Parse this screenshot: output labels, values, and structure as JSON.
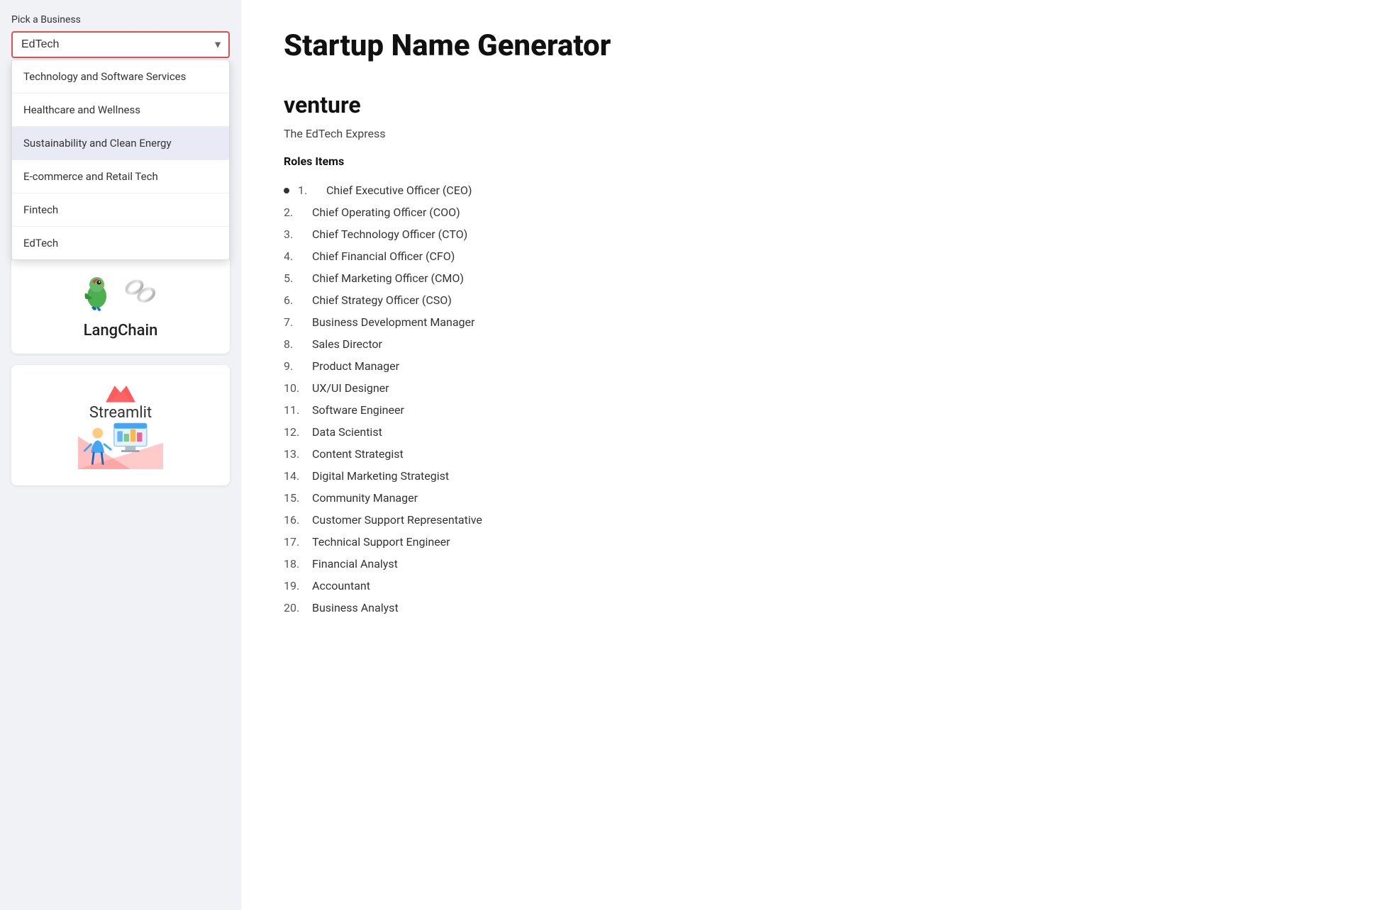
{
  "sidebar": {
    "pick_label": "Pick a Business",
    "input_value": "EdTech",
    "dropdown_items": [
      {
        "label": "Technology and Software Services",
        "highlighted": false
      },
      {
        "label": "Healthcare and Wellness",
        "highlighted": false
      },
      {
        "label": "Sustainability and Clean Energy",
        "highlighted": true
      },
      {
        "label": "E-commerce and Retail Tech",
        "highlighted": false
      },
      {
        "label": "Fintech",
        "highlighted": false
      },
      {
        "label": "EdTech",
        "highlighted": false
      }
    ],
    "langchain_label": "LangChain",
    "streamlit_label": "Streamlit"
  },
  "main": {
    "page_title": "Startup Name Generator",
    "venture_heading": "venture",
    "business_name": "The EdTech Express",
    "roles_heading": "Roles Items",
    "roles": [
      {
        "num": "1.",
        "label": "Chief Executive Officer (CEO)",
        "bullet": true
      },
      {
        "num": "2.",
        "label": "Chief Operating Officer (COO)",
        "bullet": false
      },
      {
        "num": "3.",
        "label": "Chief Technology Officer (CTO)",
        "bullet": false
      },
      {
        "num": "4.",
        "label": "Chief Financial Officer (CFO)",
        "bullet": false
      },
      {
        "num": "5.",
        "label": "Chief Marketing Officer (CMO)",
        "bullet": false
      },
      {
        "num": "6.",
        "label": "Chief Strategy Officer (CSO)",
        "bullet": false
      },
      {
        "num": "7.",
        "label": "Business Development Manager",
        "bullet": false
      },
      {
        "num": "8.",
        "label": "Sales Director",
        "bullet": false
      },
      {
        "num": "9.",
        "label": "Product Manager",
        "bullet": false
      },
      {
        "num": "10.",
        "label": "UX/UI Designer",
        "bullet": false
      },
      {
        "num": "11.",
        "label": "Software Engineer",
        "bullet": false
      },
      {
        "num": "12.",
        "label": "Data Scientist",
        "bullet": false
      },
      {
        "num": "13.",
        "label": "Content Strategist",
        "bullet": false
      },
      {
        "num": "14.",
        "label": "Digital Marketing Strategist",
        "bullet": false
      },
      {
        "num": "15.",
        "label": "Community Manager",
        "bullet": false
      },
      {
        "num": "16.",
        "label": "Customer Support Representative",
        "bullet": false
      },
      {
        "num": "17.",
        "label": "Technical Support Engineer",
        "bullet": false
      },
      {
        "num": "18.",
        "label": "Financial Analyst",
        "bullet": false
      },
      {
        "num": "19.",
        "label": "Accountant",
        "bullet": false
      },
      {
        "num": "20.",
        "label": "Business Analyst",
        "bullet": false
      }
    ]
  }
}
